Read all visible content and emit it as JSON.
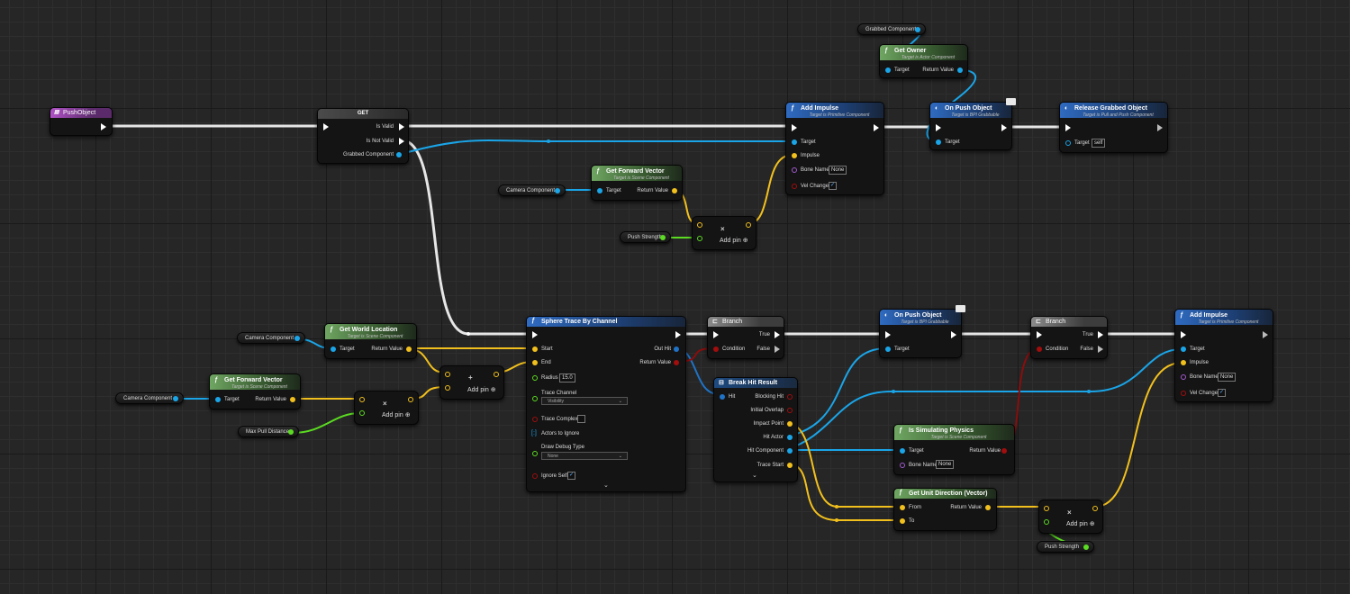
{
  "colors": {
    "exec": "#ffffff",
    "object": "#1aa5e8",
    "vector": "#f2c01d",
    "float": "#5bdb22",
    "bool": "#a20d0d",
    "name": "#a35ad0"
  },
  "common": {
    "target": "Target",
    "return_value": "Return Value",
    "add_pin": "Add pin",
    "self": "self",
    "none": "None",
    "bone_name": "Bone Name",
    "vel_change": "Vel Change",
    "impulse": "Impulse",
    "condition": "Condition",
    "true_lbl": "True",
    "false_lbl": "False",
    "from": "From",
    "to": "To",
    "check": "✓",
    "plus": "+",
    "cross": "×"
  },
  "vars": {
    "camera_component": "Camera Component",
    "push_strength": "Push Strength",
    "max_pull_distance": "Max Pull Distance",
    "grabbed_component": "Grabbed Component"
  },
  "event": {
    "title": "PushObject"
  },
  "get": {
    "title": "GET",
    "is_valid": "Is Valid",
    "is_not_valid": "Is Not Valid",
    "grabbed_component": "Grabbed Component"
  },
  "add_impulse": {
    "title": "Add Impulse",
    "sub": "Target is Primitive Component"
  },
  "get_owner": {
    "title": "Get Owner",
    "sub": "Target is Actor Component"
  },
  "on_push": {
    "title": "On Push Object",
    "sub": "Target is BPI Grabbable"
  },
  "release": {
    "title": "Release Grabbed Object",
    "sub": "Target is Pull and Push Component"
  },
  "forward": {
    "title": "Get Forward Vector",
    "sub": "Target is Scene Component"
  },
  "world_loc": {
    "title": "Get World Location",
    "sub": "Target is Scene Component"
  },
  "trace": {
    "title": "Sphere Trace By Channel",
    "start": "Start",
    "end": "End",
    "radius": "Radius",
    "radius_value": "15.0",
    "trace_channel": "Trace Channel",
    "trace_channel_value": "Visibility",
    "trace_complex": "Trace Complex",
    "actors_to_ignore": "Actors to Ignore",
    "draw_debug": "Draw Debug Type",
    "draw_debug_value": "None",
    "ignore_self": "Ignore Self",
    "out_hit": "Out Hit",
    "return_value": "Return Value"
  },
  "branch": {
    "title": "Branch"
  },
  "break_hit": {
    "title": "Break Hit Result",
    "hit": "Hit",
    "blocking_hit": "Blocking Hit",
    "initial_overlap": "Initial Overlap",
    "impact_point": "Impact Point",
    "hit_actor": "Hit Actor",
    "hit_component": "Hit Component",
    "trace_start": "Trace Start"
  },
  "simulating": {
    "title": "Is Simulating Physics",
    "sub": "Target is Scene Component"
  },
  "unit_dir": {
    "title": "Get Unit Direction (Vector)"
  }
}
